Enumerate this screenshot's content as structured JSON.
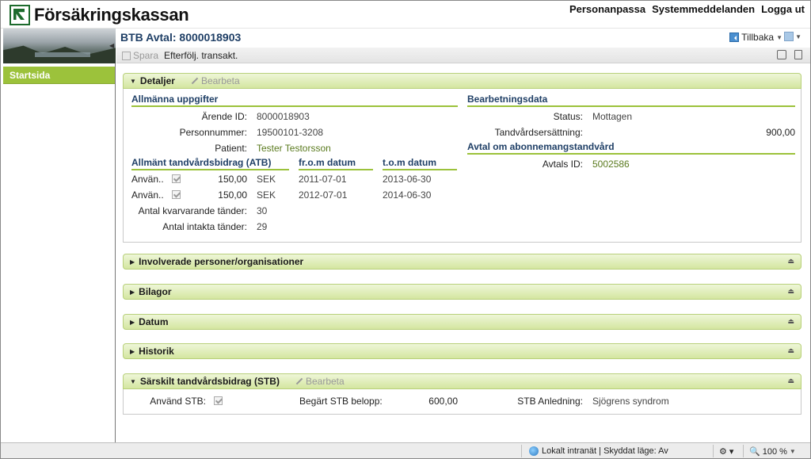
{
  "header": {
    "logo_text": "Försäkringskassan",
    "links": [
      "Personanpassa",
      "Systemmeddelanden",
      "Logga ut"
    ]
  },
  "sidebar": {
    "items": [
      {
        "label": "Startsida",
        "active": true
      }
    ]
  },
  "page": {
    "title": "BTB Avtal: 8000018903",
    "back_label": "Tillbaka"
  },
  "toolbar": {
    "save_label": "Spara",
    "follow_label": "Efterfölj. transakt."
  },
  "detaljer": {
    "title": "Detaljer",
    "edit_label": "Bearbeta",
    "allmanna": {
      "heading": "Allmänna uppgifter",
      "arende_label": "Ärende ID:",
      "arende_value": "8000018903",
      "person_label": "Personnummer:",
      "person_value": "19500101-3208",
      "patient_label": "Patient:",
      "patient_value": "Tester Testorsson"
    },
    "atb": {
      "heading": "Allmänt tandvårdsbidrag (ATB)",
      "from_heading": "fr.o.m datum",
      "tom_heading": "t.o.m datum",
      "rows": [
        {
          "label": "Använ..",
          "checked": true,
          "amount": "150,00",
          "currency": "SEK",
          "from": "2011-07-01",
          "to": "2013-06-30"
        },
        {
          "label": "Använ..",
          "checked": true,
          "amount": "150,00",
          "currency": "SEK",
          "from": "2012-07-01",
          "to": "2014-06-30"
        }
      ],
      "kvar_label": "Antal kvarvarande tänder:",
      "kvar_value": "30",
      "intakta_label": "Antal intakta tänder:",
      "intakta_value": "29"
    },
    "bearbetning": {
      "heading": "Bearbetningsdata",
      "status_label": "Status:",
      "status_value": "Mottagen",
      "ersattning_label": "Tandvårdsersättning:",
      "ersattning_value": "900,00"
    },
    "avtal": {
      "heading": "Avtal om abonnemangstandvård",
      "avtals_label": "Avtals ID:",
      "avtals_value": "5002586"
    }
  },
  "collapsed_panels": [
    "Involverade personer/organisationer",
    "Bilagor",
    "Datum",
    "Historik"
  ],
  "stb": {
    "title": "Särskilt tandvårdsbidrag (STB)",
    "edit_label": "Bearbeta",
    "anvand_label": "Använd STB:",
    "anvand_checked": true,
    "belopp_label": "Begärt STB belopp:",
    "belopp_value": "600,00",
    "anledning_label": "STB Anledning:",
    "anledning_value": "Sjögrens syndrom"
  },
  "statusbar": {
    "zone": "Lokalt intranät | Skyddat läge: Av",
    "zoom": "100 %"
  },
  "colors": {
    "accent_green": "#9cc23b",
    "title_blue": "#1f3f66",
    "panel_head": "#d4e6a0"
  }
}
